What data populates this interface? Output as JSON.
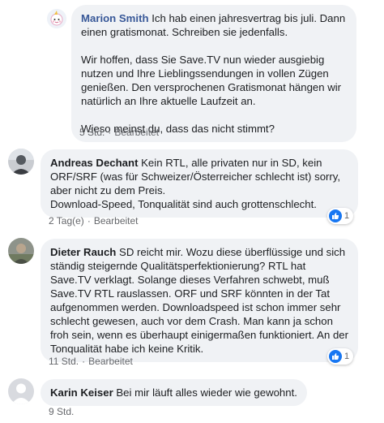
{
  "comments": [
    {
      "author": "Marion Smith",
      "paragraphs": [
        "Ich hab einen jahresvertrag bis juli. Dann einen gratismonat. Schreiben sie jedenfalls.",
        "Wir hoffen, dass Sie Save.TV nun wieder ausgiebig nutzen und Ihre Lieblingssendungen in vollen Zügen genießen. Den versprochenen Gratismonat hängen wir natürlich an Ihre aktuelle Laufzeit an.",
        "Wieso meinst du, dass das nicht stimmt?"
      ],
      "time": "5 Std.",
      "status": "Bearbeitet"
    },
    {
      "author": "Andreas Dechant",
      "text": "Kein RTL, alle privaten nur in SD, kein ORF/SRF (was für Schweizer/Österreicher schlecht ist) sorry, aber nicht zu dem Preis.",
      "text2": "Download-Speed, Tonqualität sind auch grottenschlecht.",
      "time": "2 Tag(e)",
      "status": "Bearbeitet",
      "reaction_count": "1"
    },
    {
      "author": "Dieter Rauch",
      "text": "SD reicht mir. Wozu diese überflüssige und sich ständig steigernde Qualitätsperfektionierung? RTL hat Save.TV verklagt. Solange dieses Verfahren schwebt, muß Save.TV RTL rauslassen. ORF und SRF könnten in der Tat aufgenommen werden. Downloadspeed ist schon immer sehr schlecht gewesen, auch vor dem Crash. Man kann ja schon froh sein, wenn es überhaupt einigermaßen funktioniert. An der Tonqualität habe ich keine Kritik.",
      "time": "11 Std.",
      "status": "Bearbeitet",
      "reaction_count": "1"
    },
    {
      "author": "Karin Keiser",
      "text": "Bei mir läuft alles wieder wie gewohnt.",
      "time": "9 Std."
    }
  ],
  "colors": {
    "bubble": "#f0f2f5",
    "link": "#385898",
    "like": "#1877f2",
    "meta": "#65676b"
  },
  "icons": [
    "avatar-icon",
    "like-icon"
  ]
}
